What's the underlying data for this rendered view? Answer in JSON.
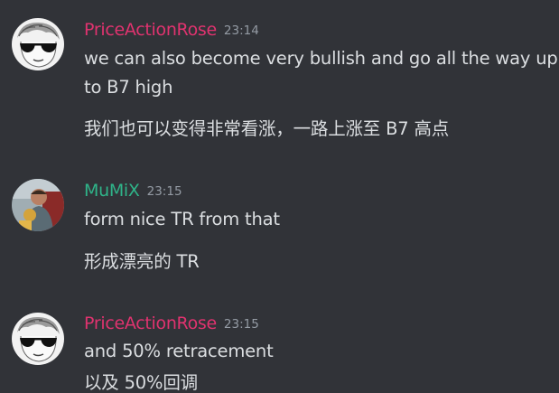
{
  "colors": {
    "background": "#313338",
    "text": "#dbdee1",
    "timestamp": "#949ba4",
    "pink_user": "#e0336f",
    "green_user": "#2fb489"
  },
  "messages": [
    {
      "username": "PriceActionRose",
      "timestamp": "23:14",
      "avatar_icon": "sunglasses-sketch-avatar",
      "lines": [
        "we can also become very bullish and go all the way up",
        "to B7 high",
        "我们也可以变得非常看涨，一路上涨至 B7 高点"
      ]
    },
    {
      "username": "MuMiX",
      "timestamp": "23:15",
      "avatar_icon": "photo-avatar",
      "lines": [
        "form nice TR from that",
        "形成漂亮的 TR"
      ]
    },
    {
      "username": "PriceActionRose",
      "timestamp": "23:15",
      "avatar_icon": "sunglasses-sketch-avatar",
      "lines": [
        "and 50% retracement",
        "以及 50%回调"
      ]
    }
  ]
}
